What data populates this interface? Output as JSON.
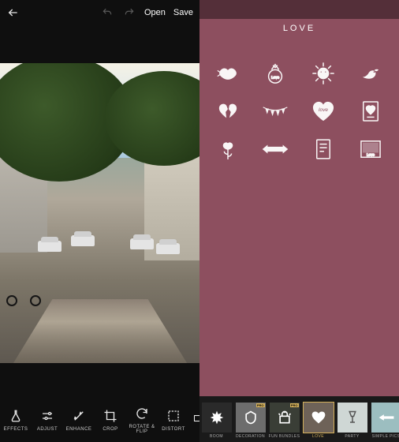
{
  "left": {
    "actions": {
      "open": "Open",
      "save": "Save"
    },
    "tools": [
      {
        "id": "effects",
        "label": "EFFECTS"
      },
      {
        "id": "adjust",
        "label": "ADJUST"
      },
      {
        "id": "enhance",
        "label": "ENHANCE"
      },
      {
        "id": "crop",
        "label": "CROP"
      },
      {
        "id": "rotate",
        "label": "ROTATE & FLIP"
      },
      {
        "id": "distort",
        "label": "DISTORT"
      },
      {
        "id": "more",
        "label": ""
      }
    ]
  },
  "right": {
    "title": "LOVE",
    "stickers": [
      {
        "id": "kiss"
      },
      {
        "id": "ring"
      },
      {
        "id": "sun"
      },
      {
        "id": "bird"
      },
      {
        "id": "broken-heart"
      },
      {
        "id": "bunting"
      },
      {
        "id": "heart-love"
      },
      {
        "id": "card"
      },
      {
        "id": "flower"
      },
      {
        "id": "ribbon"
      },
      {
        "id": "note"
      },
      {
        "id": "polaroid"
      }
    ],
    "categories": [
      {
        "id": "boom",
        "label": "BOOM",
        "pro": false,
        "bg": "#2a2a2a"
      },
      {
        "id": "decoration",
        "label": "DECORATION",
        "pro": true,
        "bg": "#6d6d6d"
      },
      {
        "id": "fun-bundles",
        "label": "FUN BUNDLES",
        "pro": true,
        "bg": "#3a3e36"
      },
      {
        "id": "love",
        "label": "LOVE",
        "pro": false,
        "bg": "#6e6258",
        "selected": true
      },
      {
        "id": "party",
        "label": "PARTY",
        "pro": false,
        "bg": "#cfd7d5"
      },
      {
        "id": "simple",
        "label": "SIMPLE PICS",
        "pro": false,
        "bg": "#9cbec0"
      }
    ]
  }
}
